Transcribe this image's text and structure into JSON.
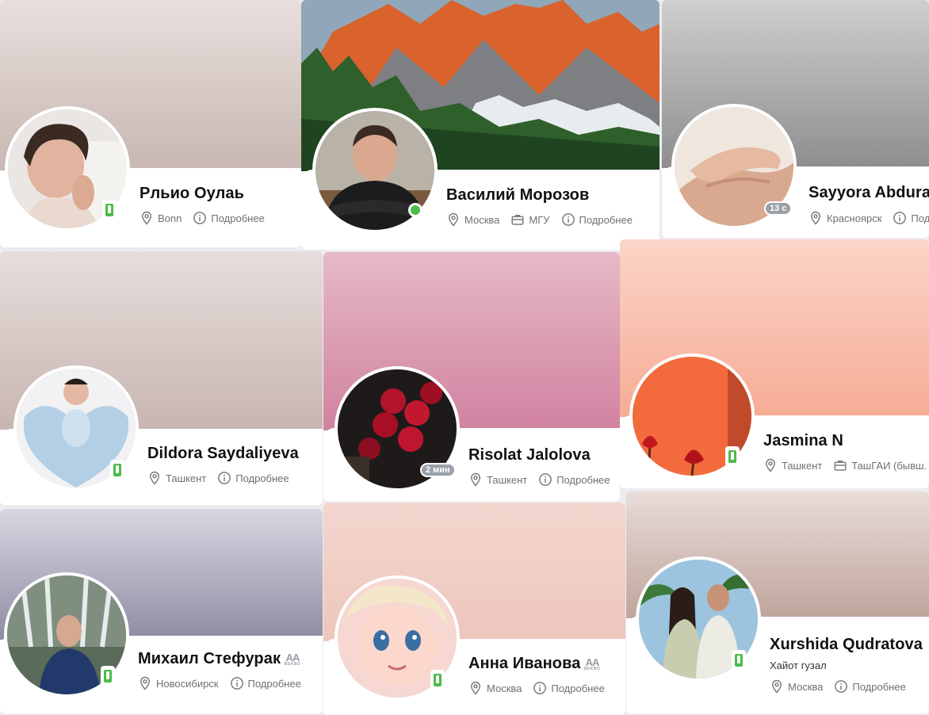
{
  "profiles": [
    {
      "name": "Рльио Оулаь",
      "location": "Bonn",
      "more": "Подробнее",
      "device": "mobile",
      "avatar_icon": "teen-boy-photo",
      "cover_color": "#d6c8c3"
    },
    {
      "name": "Василий Морозов",
      "location": "Москва",
      "education": "МГУ",
      "more": "Подробнее",
      "online": true,
      "avatar_icon": "man-leather-jacket-photo",
      "cover_icon": "mountain-forest-photo"
    },
    {
      "name": "Sayyora Abdural",
      "location": "Красноярск",
      "more": "Под",
      "last_seen": "13 с",
      "avatar_icon": "holding-hands-photo",
      "cover_color": "#a9a9a9"
    },
    {
      "name": "Dildora Saydaliyeva",
      "location": "Ташкент",
      "more": "Подробнее",
      "device": "mobile",
      "avatar_icon": "baby-blanket-photo",
      "cover_color": "#d4c5c2"
    },
    {
      "name": "Risolat Jalolova",
      "location": "Ташкент",
      "more": "Подробнее",
      "last_seen": "2 мин",
      "avatar_icon": "red-roses-photo",
      "cover_color": "#d68aa2"
    },
    {
      "name": "Jasmina N",
      "location": "Ташкент",
      "work": "ТашГАИ (бывш.",
      "device": "mobile",
      "avatar_icon": "orange-tulips-photo",
      "cover_color": "#f8bca7"
    },
    {
      "name": "Михаил Стефурак",
      "location": "Новосибирск",
      "more": "Подробнее",
      "device": "mobile",
      "badge": "AA",
      "badge_sub": "BEKBO",
      "avatar_icon": "man-fountain-photo",
      "cover_color": "#a7a5b8"
    },
    {
      "name": "Анна Иванова",
      "location": "Москва",
      "more": "Подробнее",
      "device": "mobile",
      "badge": "AA",
      "badge_sub": "BEKBO",
      "avatar_icon": "cartoon-girl-photo",
      "cover_color": "#f1cfc7"
    },
    {
      "name": "Xurshida Qudratova",
      "status": "Хайот гузал",
      "location": "Москва",
      "more": "Подробнее",
      "device": "mobile",
      "avatar_icon": "couple-palms-photo",
      "cover_color": "#c2aaa2"
    }
  ]
}
